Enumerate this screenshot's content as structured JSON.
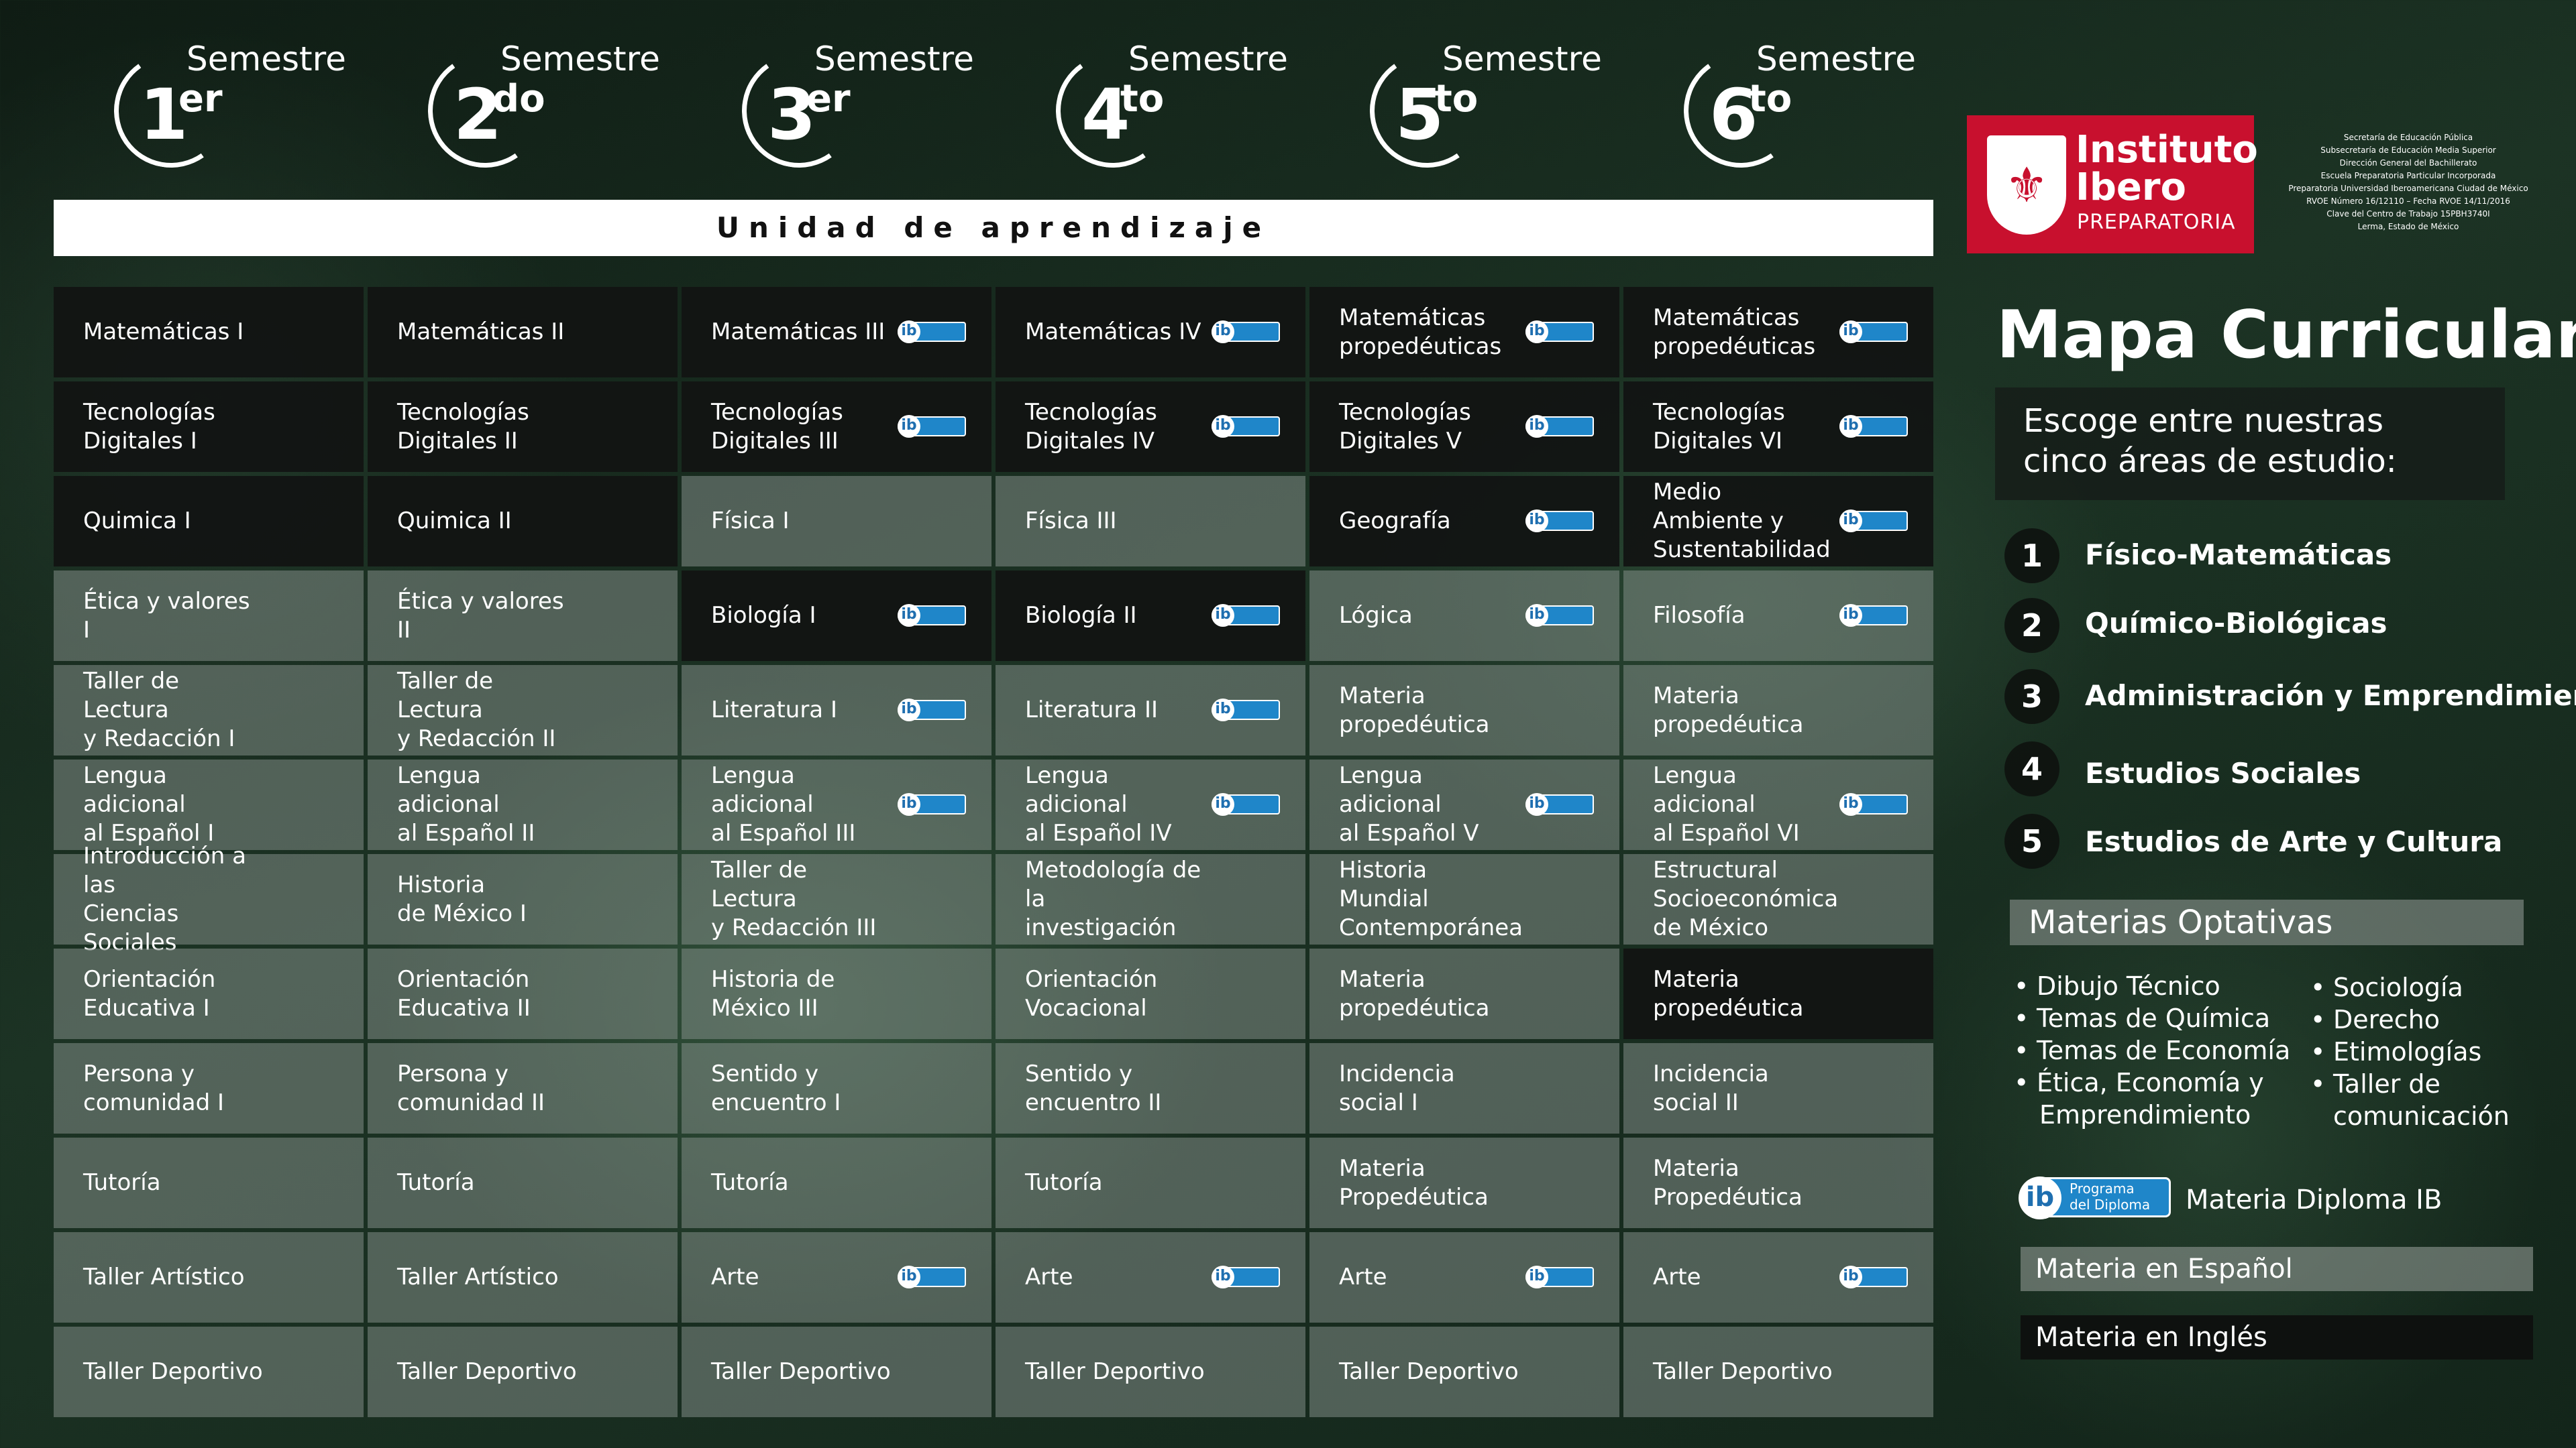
{
  "header": {
    "semesters": [
      {
        "label": "Semestre",
        "num": "1",
        "suffix": "er"
      },
      {
        "label": "Semestre",
        "num": "2",
        "suffix": "do"
      },
      {
        "label": "Semestre",
        "num": "3",
        "suffix": "er"
      },
      {
        "label": "Semestre",
        "num": "4",
        "suffix": "to"
      },
      {
        "label": "Semestre",
        "num": "5",
        "suffix": "to"
      },
      {
        "label": "Semestre",
        "num": "6",
        "suffix": "to"
      }
    ],
    "unidad": "Unidad de aprendizaje"
  },
  "logo": {
    "line1": "Instituto",
    "line2": "Ibero",
    "line3": "PREPARATORIA",
    "info": [
      "Secretaría de Educación Pública",
      "Subsecretaría de Educación Media Superior",
      "Dirección General del Bachillerato",
      "Escuela Preparatoria Particular Incorporada",
      "Preparatoria Universidad Iberoamericana Ciudad de México",
      "RVOE Número 16/12110 – Fecha RVOE 14/11/2016",
      "Clave del Centro de Trabajo 15PBH3740I",
      "Lerma, Estado de México"
    ]
  },
  "sidebar": {
    "title": "Mapa Curricular",
    "subtitle_l1": "Escoge entre nuestras",
    "subtitle_l2": "cinco áreas de estudio:",
    "areas": [
      {
        "num": "1",
        "name": "Físico-Matemáticas"
      },
      {
        "num": "2",
        "name": "Químico-Biológicas"
      },
      {
        "num": "3",
        "name": "Administración y Emprendimiento"
      },
      {
        "num": "4",
        "name": "Estudios Sociales"
      },
      {
        "num": "5",
        "name": "Estudios de Arte y Cultura"
      }
    ],
    "optativas_title": "Materias Optativas",
    "optativas_left": [
      "Dibujo Técnico",
      "Temas de Química",
      "Temas de Economía",
      "Ética, Economía y",
      "Emprendimiento"
    ],
    "optativas_right": [
      "Sociología",
      "Derecho",
      "Etimologías",
      "Taller de",
      "comunicación"
    ],
    "bullet": "•",
    "legend_ib_badge": "Programa\ndel Diploma",
    "legend_ib": "Materia Diploma IB",
    "legend_es": "Materia en Español",
    "legend_en": "Materia en Inglés"
  },
  "grid": {
    "columns": [
      [
        {
          "text": "Matemáticas I",
          "lang": "en",
          "ib": false
        },
        {
          "text": "Tecnologías\nDigitales I",
          "lang": "en",
          "ib": false
        },
        {
          "text": "Quimica I",
          "lang": "en",
          "ib": false
        },
        {
          "text": "Ética y valores I",
          "lang": "es",
          "ib": false
        },
        {
          "text": "Taller de Lectura\ny Redacción I",
          "lang": "es",
          "ib": false
        },
        {
          "text": "Lengua adicional\nal Español I",
          "lang": "es",
          "ib": false
        },
        {
          "text": "Introducción a las\nCiencias Sociales",
          "lang": "es",
          "ib": false
        },
        {
          "text": "Orientación\nEducativa I",
          "lang": "es",
          "ib": false
        },
        {
          "text": "Persona y comunidad I",
          "lang": "es",
          "ib": false
        },
        {
          "text": "Tutoría",
          "lang": "es",
          "ib": false
        },
        {
          "text": "Taller Artístico",
          "lang": "es",
          "ib": false
        },
        {
          "text": "Taller Deportivo",
          "lang": "es",
          "ib": false
        }
      ],
      [
        {
          "text": "Matemáticas II",
          "lang": "en",
          "ib": false
        },
        {
          "text": "Tecnologías\nDigitales II",
          "lang": "en",
          "ib": false
        },
        {
          "text": "Quimica II",
          "lang": "en",
          "ib": false
        },
        {
          "text": "Ética y valores II",
          "lang": "es",
          "ib": false
        },
        {
          "text": "Taller de Lectura\ny Redacción II",
          "lang": "es",
          "ib": false
        },
        {
          "text": "Lengua adicional\nal Español II",
          "lang": "es",
          "ib": false
        },
        {
          "text": "Historia\nde México I",
          "lang": "es",
          "ib": false
        },
        {
          "text": "Orientación\nEducativa II",
          "lang": "es",
          "ib": false
        },
        {
          "text": "Persona y comunidad II",
          "lang": "es",
          "ib": false
        },
        {
          "text": "Tutoría",
          "lang": "es",
          "ib": false
        },
        {
          "text": "Taller Artístico",
          "lang": "es",
          "ib": false
        },
        {
          "text": "Taller Deportivo",
          "lang": "es",
          "ib": false
        }
      ],
      [
        {
          "text": "Matemáticas III",
          "lang": "en",
          "ib": true
        },
        {
          "text": "Tecnologías\nDigitales III",
          "lang": "en",
          "ib": true
        },
        {
          "text": "Física I",
          "lang": "es",
          "ib": false
        },
        {
          "text": "Biología I",
          "lang": "en",
          "ib": true
        },
        {
          "text": "Literatura I",
          "lang": "es",
          "ib": true
        },
        {
          "text": "Lengua adicional\nal Español III",
          "lang": "es",
          "ib": true
        },
        {
          "text": "Taller de Lectura\ny Redacción III",
          "lang": "es",
          "ib": false
        },
        {
          "text": "Historia de\nMéxico III",
          "lang": "es",
          "ib": false
        },
        {
          "text": "Sentido y encuentro I",
          "lang": "es",
          "ib": false
        },
        {
          "text": "Tutoría",
          "lang": "es",
          "ib": false
        },
        {
          "text": "Arte",
          "lang": "es",
          "ib": true
        },
        {
          "text": "Taller Deportivo",
          "lang": "es",
          "ib": false
        }
      ],
      [
        {
          "text": "Matemáticas IV",
          "lang": "en",
          "ib": true
        },
        {
          "text": "Tecnologías\nDigitales IV",
          "lang": "en",
          "ib": true
        },
        {
          "text": "Física III",
          "lang": "es",
          "ib": false
        },
        {
          "text": "Biología II",
          "lang": "en",
          "ib": true
        },
        {
          "text": "Literatura II",
          "lang": "es",
          "ib": true
        },
        {
          "text": "Lengua adicional\nal Español IV",
          "lang": "es",
          "ib": true
        },
        {
          "text": "Metodología de la\ninvestigación",
          "lang": "es",
          "ib": false
        },
        {
          "text": "Orientación\nVocacional",
          "lang": "es",
          "ib": false
        },
        {
          "text": "Sentido y encuentro II",
          "lang": "es",
          "ib": false
        },
        {
          "text": "Tutoría",
          "lang": "es",
          "ib": false
        },
        {
          "text": "Arte",
          "lang": "es",
          "ib": true
        },
        {
          "text": "Taller Deportivo",
          "lang": "es",
          "ib": false
        }
      ],
      [
        {
          "text": "Matemáticas\npropedéuticas",
          "lang": "en",
          "ib": true
        },
        {
          "text": "Tecnologías\nDigitales V",
          "lang": "en",
          "ib": true
        },
        {
          "text": "Geografía",
          "lang": "en",
          "ib": true
        },
        {
          "text": "Lógica",
          "lang": "es",
          "ib": true
        },
        {
          "text": "Materia\npropedéutica",
          "lang": "es",
          "ib": false
        },
        {
          "text": "Lengua adicional\nal Español V",
          "lang": "es",
          "ib": true
        },
        {
          "text": "Historia Mundial\nContemporánea",
          "lang": "es",
          "ib": false
        },
        {
          "text": "Materia\npropedéutica",
          "lang": "es",
          "ib": false
        },
        {
          "text": "Incidencia social I",
          "lang": "es",
          "ib": false
        },
        {
          "text": "Materia\nPropedéutica",
          "lang": "es",
          "ib": false
        },
        {
          "text": "Arte",
          "lang": "es",
          "ib": true
        },
        {
          "text": "Taller Deportivo",
          "lang": "es",
          "ib": false
        }
      ],
      [
        {
          "text": "Matemáticas\npropedéuticas",
          "lang": "en",
          "ib": true
        },
        {
          "text": "Tecnologías\nDigitales VI",
          "lang": "en",
          "ib": true
        },
        {
          "text": "Medio Ambiente y\nSustentabilidad",
          "lang": "en",
          "ib": true
        },
        {
          "text": "Filosofía",
          "lang": "es",
          "ib": true
        },
        {
          "text": "Materia\npropedéutica",
          "lang": "es",
          "ib": false
        },
        {
          "text": "Lengua adicional\nal Español VI",
          "lang": "es",
          "ib": true
        },
        {
          "text": "Estructural\nSocioeconómica\nde México",
          "lang": "es",
          "ib": false
        },
        {
          "text": "Materia\npropedéutica",
          "lang": "en",
          "ib": false
        },
        {
          "text": "Incidencia social II",
          "lang": "es",
          "ib": false
        },
        {
          "text": "Materia\nPropedéutica",
          "lang": "es",
          "ib": false
        },
        {
          "text": "Arte",
          "lang": "es",
          "ib": true
        },
        {
          "text": "Taller Deportivo",
          "lang": "es",
          "ib": false
        }
      ]
    ]
  }
}
